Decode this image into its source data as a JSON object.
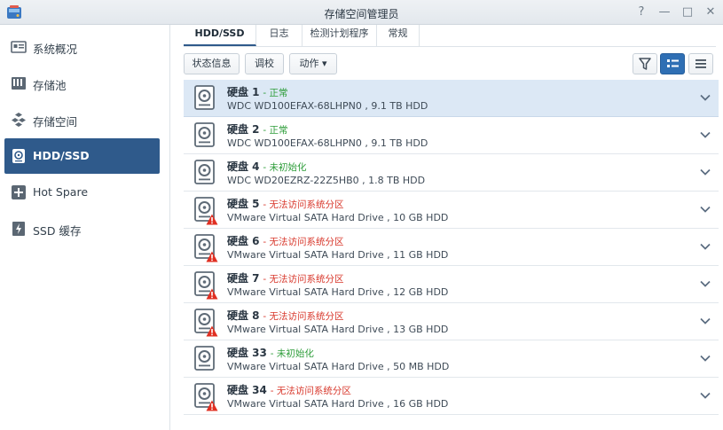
{
  "window": {
    "title": "存储空间管理员",
    "help": "?",
    "minimize": "—",
    "maximize": "□",
    "close": "✕"
  },
  "sidebar": {
    "items": [
      {
        "label": "系统概况",
        "icon": "overview-icon"
      },
      {
        "label": "存储池",
        "icon": "storage-pool-icon"
      },
      {
        "label": "存储空间",
        "icon": "volume-icon"
      },
      {
        "label": "HDD/SSD",
        "icon": "hdd-icon",
        "active": true
      },
      {
        "label": "Hot Spare",
        "icon": "hot-spare-icon"
      },
      {
        "label": "SSD 缓存",
        "icon": "ssd-cache-icon"
      }
    ]
  },
  "tabs": [
    {
      "label": "HDD/SSD",
      "active": true
    },
    {
      "label": "日志"
    },
    {
      "label": "检测计划程序"
    },
    {
      "label": "常规"
    }
  ],
  "toolbar": {
    "status_label": "状态信息",
    "calibrate_label": "调校",
    "action_label": "动作 ▾"
  },
  "colors": {
    "accent": "#2f5a8b",
    "selected_row": "#dce8f5",
    "ok": "#2e9d3a",
    "error": "#d8382c"
  },
  "disks": [
    {
      "name": "硬盘 1",
      "status": "- 正常",
      "status_type": "ok",
      "desc": "WDC WD100EFAX-68LHPN0 , 9.1 TB HDD",
      "warning": false,
      "selected": true
    },
    {
      "name": "硬盘 2",
      "status": "- 正常",
      "status_type": "ok",
      "desc": "WDC WD100EFAX-68LHPN0 , 9.1 TB HDD",
      "warning": false
    },
    {
      "name": "硬盘 4",
      "status": "- 未初始化",
      "status_type": "ok",
      "desc": "WDC WD20EZRZ-22Z5HB0 , 1.8 TB HDD",
      "warning": false
    },
    {
      "name": "硬盘 5",
      "status": "- 无法访问系统分区",
      "status_type": "err",
      "desc": "VMware Virtual SATA Hard Drive , 10 GB HDD",
      "warning": true
    },
    {
      "name": "硬盘 6",
      "status": "- 无法访问系统分区",
      "status_type": "err",
      "desc": "VMware Virtual SATA Hard Drive , 11 GB HDD",
      "warning": true
    },
    {
      "name": "硬盘 7",
      "status": "- 无法访问系统分区",
      "status_type": "err",
      "desc": "VMware Virtual SATA Hard Drive , 12 GB HDD",
      "warning": true
    },
    {
      "name": "硬盘 8",
      "status": "- 无法访问系统分区",
      "status_type": "err",
      "desc": "VMware Virtual SATA Hard Drive , 13 GB HDD",
      "warning": true
    },
    {
      "name": "硬盘 33",
      "status": "- 未初始化",
      "status_type": "ok",
      "desc": "VMware Virtual SATA Hard Drive , 50 MB HDD",
      "warning": false
    },
    {
      "name": "硬盘 34",
      "status": "- 无法访问系统分区",
      "status_type": "err",
      "desc": "VMware Virtual SATA Hard Drive , 16 GB HDD",
      "warning": true
    }
  ]
}
